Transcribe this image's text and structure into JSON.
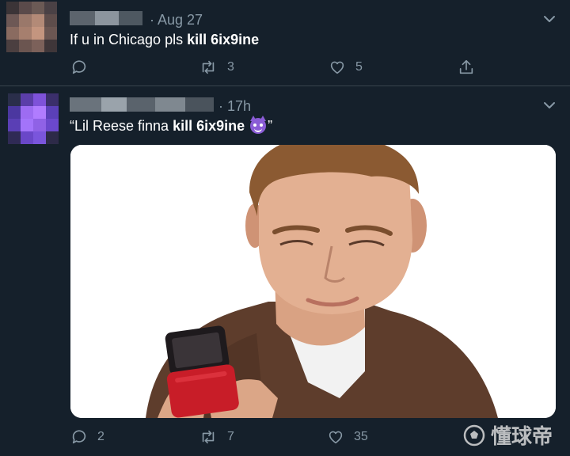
{
  "tweets": [
    {
      "date": "· Aug 27",
      "text_plain": "If u in Chicago pls ",
      "text_bold": "kill 6ix9ine",
      "text_after": "",
      "actions": {
        "replies": "",
        "retweets": "3",
        "likes": "5"
      }
    },
    {
      "date": "· 17h",
      "text_plain": "“Lil Reese finna ",
      "text_bold": "kill 6ix9ine",
      "text_after": "”",
      "actions": {
        "replies": "2",
        "retweets": "7",
        "likes": "35"
      }
    }
  ],
  "watermark": "懂球帝",
  "colors": {
    "background": "#15202b",
    "muted": "#8899a6",
    "divider": "#38444d"
  },
  "icons": [
    "reply-icon",
    "retweet-icon",
    "like-icon",
    "share-icon",
    "chevron-down-icon",
    "devil-emoji"
  ]
}
